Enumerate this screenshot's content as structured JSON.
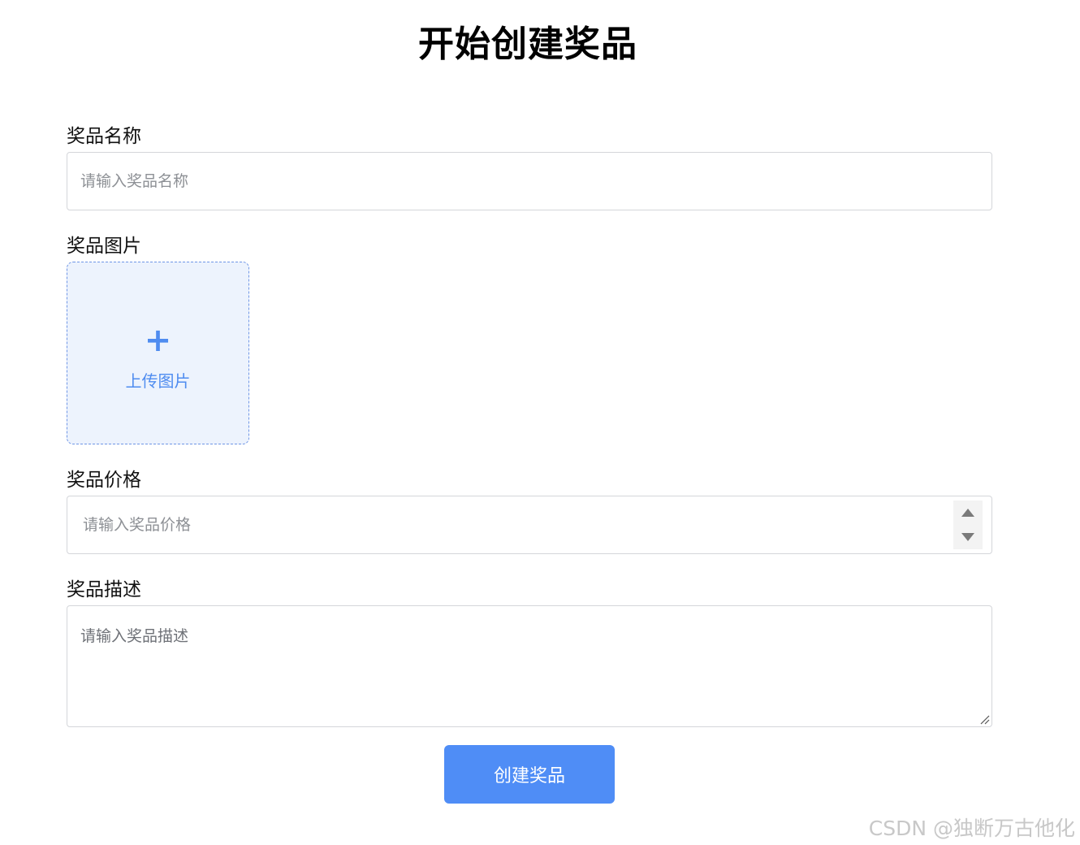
{
  "page": {
    "title": "开始创建奖品"
  },
  "form": {
    "name": {
      "label": "奖品名称",
      "placeholder": "请输入奖品名称",
      "value": ""
    },
    "image": {
      "label": "奖品图片",
      "upload_icon": "plus-icon",
      "upload_icon_glyph": "+",
      "upload_text": "上传图片"
    },
    "price": {
      "label": "奖品价格",
      "placeholder": "请输入奖品价格",
      "value": ""
    },
    "description": {
      "label": "奖品描述",
      "placeholder": "请输入奖品描述",
      "value": ""
    },
    "submit_label": "创建奖品"
  },
  "colors": {
    "accent": "#4f8df6",
    "upload_bg": "#edf3fd",
    "upload_border": "#6e95e6",
    "input_border": "#d4d6da"
  },
  "watermark": "CSDN @独断万古他化"
}
